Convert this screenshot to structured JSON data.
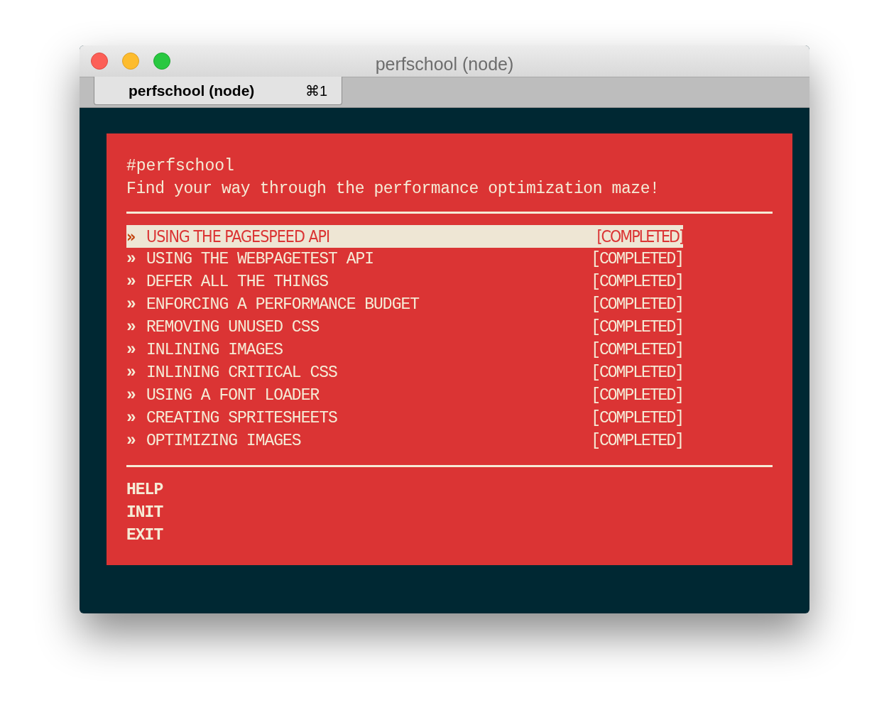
{
  "window": {
    "title": "perfschool (node)"
  },
  "tabs": [
    {
      "label": "perfschool (node)",
      "shortcut": "⌘1",
      "selected": true
    }
  ],
  "terminal": {
    "heading": "#perfschool",
    "subtitle": "Find your way through the performance optimization maze!",
    "lessons": [
      {
        "marker": "»",
        "label": "USING THE PAGESPEED API",
        "status": "[COMPLETED]",
        "selected": true
      },
      {
        "marker": "»",
        "label": "USING THE WEBPAGETEST API",
        "status": "[COMPLETED]",
        "selected": false
      },
      {
        "marker": "»",
        "label": "DEFER ALL THE THINGS",
        "status": "[COMPLETED]",
        "selected": false
      },
      {
        "marker": "»",
        "label": "ENFORCING A PERFORMANCE BUDGET",
        "status": "[COMPLETED]",
        "selected": false
      },
      {
        "marker": "»",
        "label": "REMOVING UNUSED CSS",
        "status": "[COMPLETED]",
        "selected": false
      },
      {
        "marker": "»",
        "label": "INLINING IMAGES",
        "status": "[COMPLETED]",
        "selected": false
      },
      {
        "marker": "»",
        "label": "INLINING CRITICAL CSS",
        "status": "[COMPLETED]",
        "selected": false
      },
      {
        "marker": "»",
        "label": "USING A FONT LOADER",
        "status": "[COMPLETED]",
        "selected": false
      },
      {
        "marker": "»",
        "label": "CREATING SPRITESHEETS",
        "status": "[COMPLETED]",
        "selected": false
      },
      {
        "marker": "»",
        "label": "OPTIMIZING IMAGES",
        "status": "[COMPLETED]",
        "selected": false
      }
    ],
    "commands": [
      {
        "label": "HELP"
      },
      {
        "label": "INIT"
      },
      {
        "label": "EXIT"
      }
    ]
  }
}
